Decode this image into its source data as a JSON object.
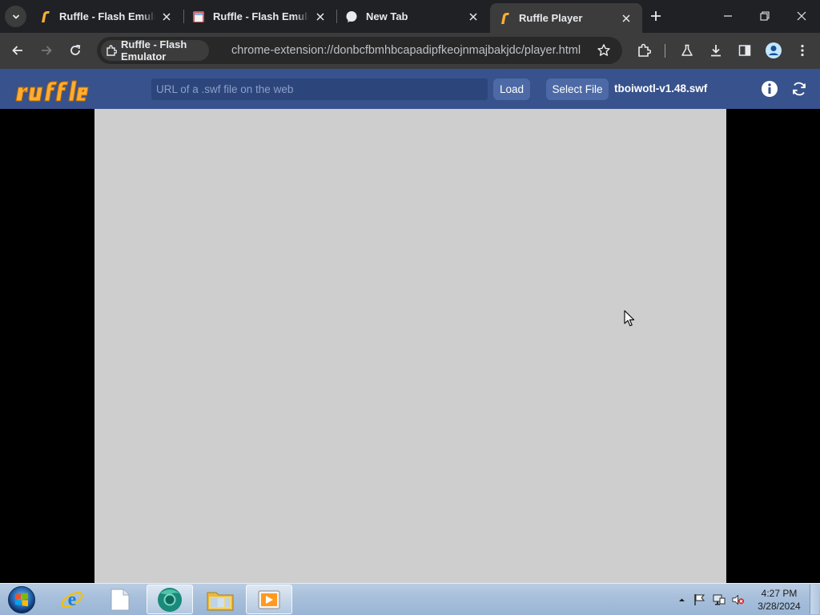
{
  "browser": {
    "tabs": [
      {
        "title": "Ruffle - Flash Emulator",
        "favicon": "ruffle-favicon",
        "active": false
      },
      {
        "title": "Ruffle - Flash Emulator",
        "favicon": "ruffle-site-favicon",
        "active": false
      },
      {
        "title": "New Tab",
        "favicon": "chrome-newtab-favicon",
        "active": false
      },
      {
        "title": "Ruffle Player",
        "favicon": "ruffle-favicon",
        "active": true
      }
    ],
    "site_chip": "Ruffle - Flash Emulator",
    "url": "chrome-extension://donbcfbmhbcapadipfkeojnmajbakjdc/player.html"
  },
  "ruffle": {
    "url_placeholder": "URL of a .swf file on the web",
    "load_label": "Load",
    "select_file_label": "Select File",
    "file_name": "tboiwotl-v1.48.swf"
  },
  "taskbar": {
    "time": "4:27 PM",
    "date": "3/28/2024",
    "pinned": [
      "internet-explorer-icon",
      "blank-document-icon",
      "chrome-app-icon",
      "file-explorer-icon",
      "media-player-icon"
    ]
  },
  "colors": {
    "ruffle_nav": "#37528c",
    "ruffle_orange": "#ffad33",
    "stage": "#cecece",
    "chrome_dark": "#202124",
    "chrome_toolbar": "#3c3c3c"
  }
}
